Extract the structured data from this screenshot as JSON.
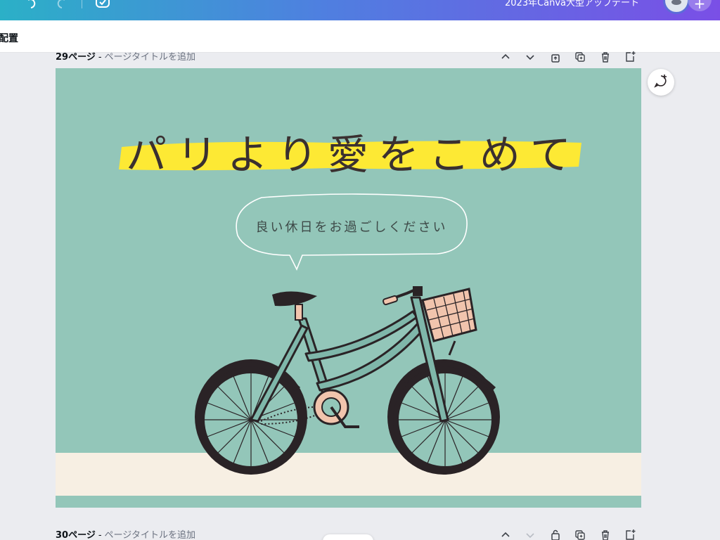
{
  "topbar": {
    "doc_title": "2023年Canva大型アップデート",
    "add_label": "+"
  },
  "subbar": {
    "label": "配置"
  },
  "pages": [
    {
      "number_label": "29ページ",
      "separator": "-",
      "title_placeholder": "ページタイトルを追加"
    },
    {
      "number_label": "30ページ",
      "separator": "-",
      "title_placeholder": "ページタイトルを追加"
    }
  ],
  "slide": {
    "headline": "パリより愛をこめて",
    "bubble_text": "良い休日をお過ごしください"
  },
  "colors": {
    "canvas_bg": "#93c6b9",
    "ground": "#f7efe3",
    "highlight": "#fde934",
    "headline": "#3a3030"
  },
  "icons": {
    "toolbar": [
      "chevron-up-icon",
      "chevron-down-icon",
      "lock-icon",
      "duplicate-icon",
      "trash-icon",
      "add-page-icon"
    ],
    "comment": "add-comment-icon"
  }
}
